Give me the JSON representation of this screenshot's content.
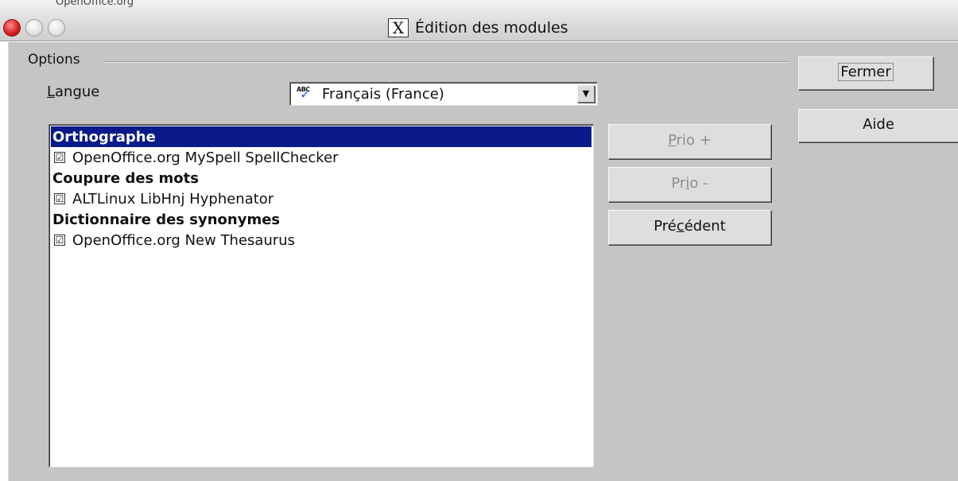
{
  "window": {
    "title": "Édition des modules",
    "app_icon": "X"
  },
  "background_fragment": "OpenOffice.org",
  "options": {
    "group_label": "Options",
    "language": {
      "label_underlined": "L",
      "label_rest": "angue",
      "icon": "spellcheck-abc-icon",
      "abc_text": "ABC",
      "value": "Français (France)",
      "dropdown_arrow": "▼"
    }
  },
  "modules": {
    "rows": [
      {
        "type": "category",
        "label": "Orthographe",
        "selected": true
      },
      {
        "type": "module",
        "label": "OpenOffice.org MySpell SpellChecker",
        "checked": true
      },
      {
        "type": "category",
        "label": "Coupure des mots",
        "selected": false
      },
      {
        "type": "module",
        "label": "ALTLinux LibHnj Hyphenator",
        "checked": true
      },
      {
        "type": "category",
        "label": "Dictionnaire des synonymes",
        "selected": false
      },
      {
        "type": "module",
        "label": "OpenOffice.org New Thesaurus",
        "checked": true
      }
    ]
  },
  "buttons": {
    "prio_up": {
      "underlined": "P",
      "rest": "rio +",
      "enabled": false
    },
    "prio_down": {
      "prefix": "Pr",
      "underlined": "i",
      "rest": "o -",
      "enabled": false
    },
    "previous": {
      "prefix": "Pré",
      "underlined": "c",
      "rest": "édent",
      "enabled": true
    },
    "close": "Fermer",
    "help": "Aide"
  },
  "checkmark": "☑",
  "colors": {
    "selection": "#0a1a8a",
    "dialog_bg": "#c5c5c5",
    "close_light": "#d21c1c",
    "disabled_text": "#8c8c8c"
  }
}
